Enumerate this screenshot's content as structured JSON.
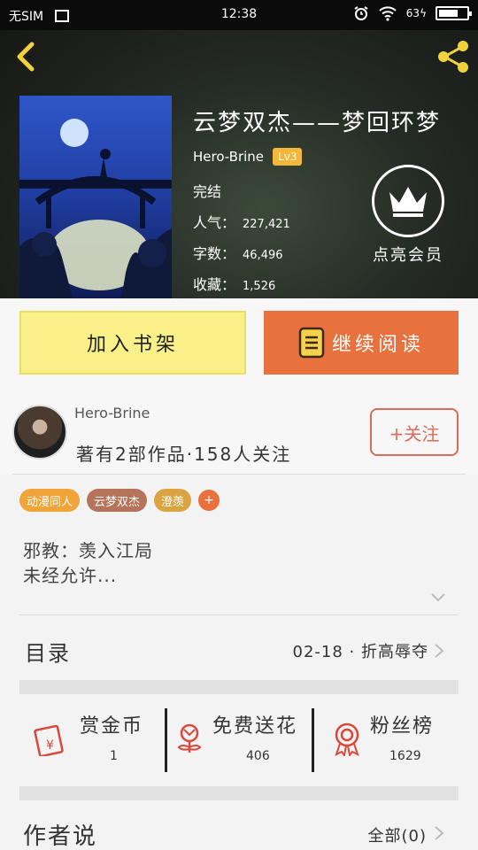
{
  "status_bar": {
    "carrier": "无SIM",
    "time": "12:38",
    "battery": "63"
  },
  "book": {
    "title": "云梦双杰——梦回环梦",
    "author": "Hero-Brine",
    "level": "Lv3",
    "status": "完结",
    "popularity_label": "人气：",
    "popularity": "227,421",
    "word_count_label": "字数：",
    "word_count": "46,496",
    "favorites_label": "收藏：",
    "favorites": "1,526"
  },
  "vip": {
    "label": "点亮会员"
  },
  "actions": {
    "add_to_shelf": "加入书架",
    "continue_reading": "继续阅读"
  },
  "author_card": {
    "name": "Hero-Brine",
    "stats": "著有2部作品·158人关注",
    "follow": "+关注"
  },
  "tags": [
    {
      "label": "动漫同人",
      "color": "#f0a43a"
    },
    {
      "label": "云梦双杰",
      "color": "#b5745a"
    },
    {
      "label": "澄羡",
      "color": "#d9a441"
    }
  ],
  "tag_add": "+",
  "description": {
    "line1": "邪教：羡入江局",
    "line2": "未经允许..."
  },
  "toc": {
    "label": "目录",
    "latest": "02-18 · 折高辱夺"
  },
  "stats": {
    "reward": {
      "label": "赏金币",
      "value": "1"
    },
    "flower": {
      "label": "免费送花",
      "value": "406"
    },
    "fans": {
      "label": "粉丝榜",
      "value": "1629"
    }
  },
  "author_say": {
    "label": "作者说",
    "all": "全部(0)"
  },
  "colors": {
    "accent_orange": "#e8713d",
    "accent_yellow": "#f9f08a",
    "follow_red": "#e06a5a",
    "icon_red": "#d9483a",
    "back_yellow": "#f2d23a"
  }
}
